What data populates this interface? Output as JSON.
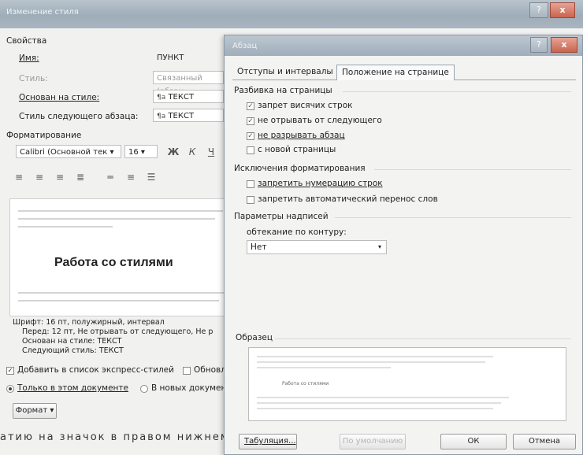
{
  "back_dialog": {
    "title": "Изменение стиля",
    "properties_label": "Свойства",
    "name_label": "Имя:",
    "name_value": "ПУНКТ",
    "style_type_label": "Стиль:",
    "style_type_value": "Связанный (абзац",
    "based_on_label": "Основан на стиле:",
    "based_on_value": "ТЕКСТ",
    "next_style_label": "Стиль следующего абзаца:",
    "next_style_value": "ТЕКСТ",
    "formatting_label": "Форматирование",
    "font_value": "Calibri (Основной тек",
    "size_value": "16",
    "bold_label": "Ж",
    "italic_label": "К",
    "underline_label": "Ч",
    "preview_text": "Работа со стилями",
    "desc_line1": "Шрифт: 16 пт, полужирный, интервал",
    "desc_line2": "Перед: 12 пт, Не отрывать от следующего, Не р",
    "desc_line3": "Основан на стиле: ТЕКСТ",
    "desc_line4": "Следующий стиль: ТЕКСТ",
    "add_quick_label": "Добавить в список экспресс-стилей",
    "update_label": "Обновл",
    "only_doc_label": "Только в этом документе",
    "new_docs_label": "В новых документ",
    "format_button": "Формат ▾",
    "footer_text": "атию на значок в правом нижнем"
  },
  "front_dialog": {
    "title": "Абзац",
    "tabs": [
      "Отступы и интервалы",
      "Положение на странице"
    ],
    "pagination_label": "Разбивка на страницы",
    "pagination_items": [
      {
        "label": "запрет висячих строк",
        "checked": true
      },
      {
        "label": "не отрывать от следующего",
        "checked": true
      },
      {
        "label": "не разрывать абзац",
        "checked": true
      },
      {
        "label": "с новой страницы",
        "checked": false
      }
    ],
    "exceptions_label": "Исключения форматирования",
    "exception_items": [
      {
        "label": "запретить нумерацию строк",
        "checked": false
      },
      {
        "label": "запретить автоматический перенос слов",
        "checked": false
      }
    ],
    "textbox_label": "Параметры надписей",
    "wrap_label": "обтекание по контуру:",
    "wrap_value": "Нет",
    "sample_label": "Образец",
    "sample_text": "Работа со стилями",
    "tabs_button": "Табуляция...",
    "default_button": "По умолчанию",
    "ok_button": "ОК",
    "cancel_button": "Отмена"
  }
}
